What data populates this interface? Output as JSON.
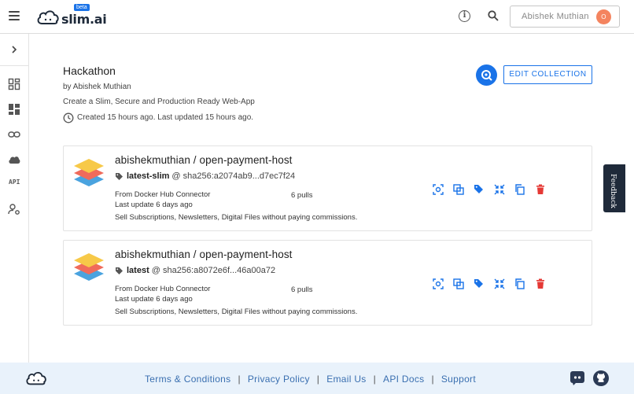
{
  "header": {
    "logo_text": "slim.ai",
    "beta_badge": "beta",
    "user_name": "Abishek Muthian",
    "avatar_initial": "O"
  },
  "collection": {
    "title": "Hackathon",
    "author": "by Abishek Muthian",
    "description": "Create a Slim, Secure and Production Ready Web-App",
    "updated": "Created 15 hours ago. Last updated 15 hours ago.",
    "edit_button": "EDIT COLLECTION"
  },
  "cards": [
    {
      "repo": "abishekmuthian / open-payment-host",
      "tag": "latest-slim",
      "sha": "@ sha256:a2074ab9...d7ec7f24",
      "from": "From  Docker Hub Connector",
      "pulls": "6 pulls",
      "last_update": "Last update  6 days ago",
      "description": "Sell Subscriptions, Newsletters, Digital Files without paying commissions."
    },
    {
      "repo": "abishekmuthian / open-payment-host",
      "tag": "latest",
      "sha": "@ sha256:a8072e6f...46a00a72",
      "from": "From  Docker Hub Connector",
      "pulls": "6 pulls",
      "last_update": "Last update  6 days ago",
      "description": "Sell Subscriptions, Newsletters, Digital Files without paying commissions."
    }
  ],
  "rail": {
    "api_label": "API"
  },
  "feedback_label": "Feedback",
  "footer": {
    "links": [
      "Terms & Conditions",
      "Privacy Policy",
      "Email Us",
      "API Docs",
      "Support"
    ],
    "separator": "|"
  },
  "colors": {
    "accent": "#1a73e8",
    "delete": "#e53935",
    "footer_bg": "#e9f2fb",
    "avatar": "#f4845f"
  },
  "icons": [
    "menu-icon",
    "info-icon",
    "search-icon",
    "chevron-right-icon",
    "dashboard-icon",
    "grid-icon",
    "link-icon",
    "cloud-icon",
    "user-settings-icon",
    "clock-icon",
    "tag-icon",
    "scan-icon",
    "compare-icon",
    "tags-icon",
    "slim-icon",
    "copy-icon",
    "delete-icon",
    "discord-icon",
    "github-icon"
  ]
}
